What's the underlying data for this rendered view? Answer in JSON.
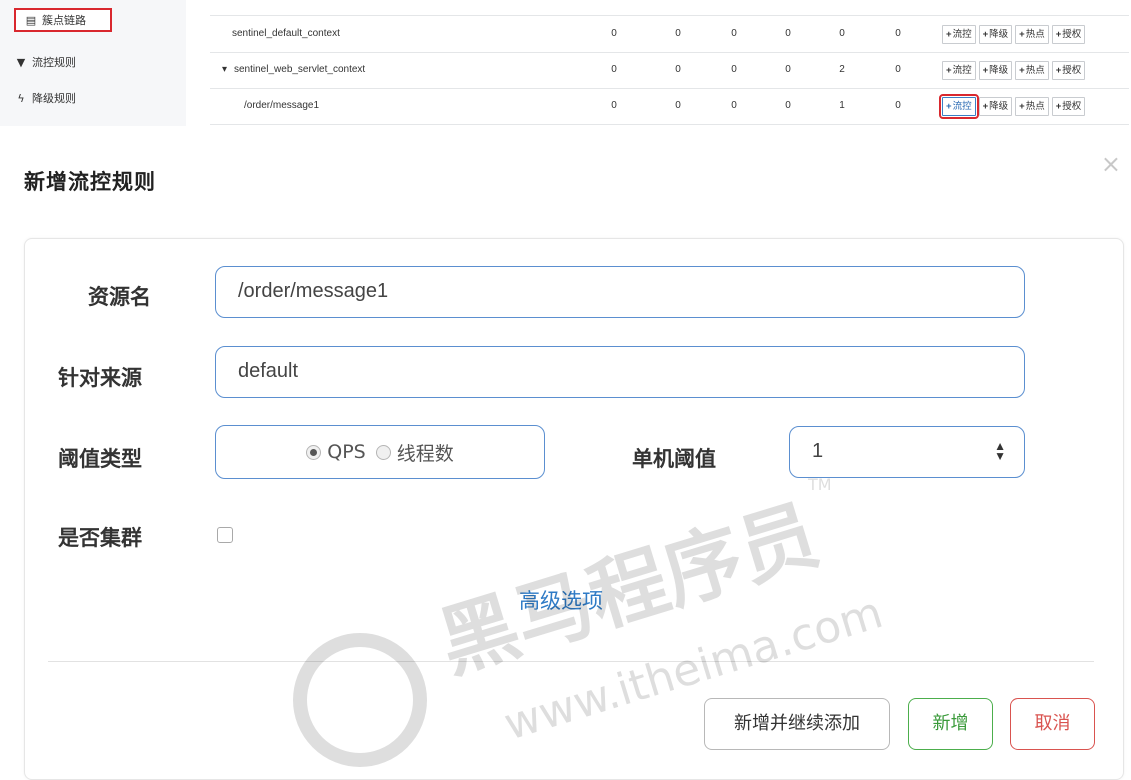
{
  "sidebar": {
    "items": [
      {
        "label": "簇点链路",
        "icon": "list-icon"
      },
      {
        "label": "流控规则",
        "icon": "filter-icon"
      },
      {
        "label": "降级规则",
        "icon": "bolt-icon"
      }
    ]
  },
  "table": {
    "rows": [
      {
        "resource": "sentinel_default_context",
        "values": [
          "0",
          "0",
          "0",
          "0",
          "0",
          "0"
        ]
      },
      {
        "resource": "sentinel_web_servlet_context",
        "values": [
          "0",
          "0",
          "0",
          "0",
          "2",
          "0"
        ]
      },
      {
        "resource": "/order/message1",
        "values": [
          "0",
          "0",
          "0",
          "0",
          "1",
          "0"
        ]
      }
    ],
    "actions": [
      "流控",
      "降级",
      "热点",
      "授权"
    ]
  },
  "modal": {
    "title": "新增流控规则",
    "close_glyph": "×",
    "form": {
      "resource_label": "资源名",
      "resource_value": "/order/message1",
      "origin_label": "针对来源",
      "origin_value": "default",
      "grade_label": "阈值类型",
      "grade_options": [
        "QPS",
        "线程数"
      ],
      "grade_selected": "QPS",
      "count_label": "单机阈值",
      "count_value": "1",
      "cluster_label": "是否集群",
      "cluster_checked": false,
      "advanced_link": "高级选项"
    },
    "buttons": {
      "add_continue": "新增并继续添加",
      "add": "新增",
      "cancel": "取消"
    }
  },
  "watermark": {
    "brand": "黑马程序员",
    "url": "www.itheima.com",
    "tm": "TM"
  },
  "colors": {
    "highlight_red": "#d9282e",
    "input_border": "#5b8fd0",
    "link_blue": "#2f7bc6",
    "add_green": "#4cae4c",
    "cancel_red": "#d9534f"
  }
}
